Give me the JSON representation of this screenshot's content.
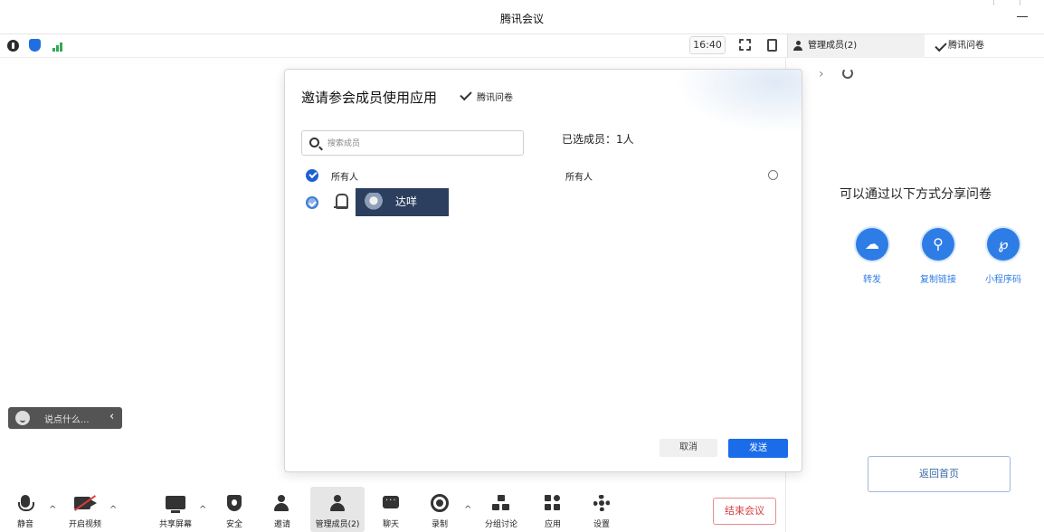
{
  "window": {
    "title": "腾讯会议"
  },
  "meetbar": {
    "time": "16:40",
    "members_tab": "管理成员(2)",
    "survey_tab": "腾讯问卷"
  },
  "dialog": {
    "title": "邀请参会成员使用应用",
    "app_name": "腾讯问卷",
    "search_placeholder": "搜索成员",
    "selected_label": "已选成员：1人",
    "all_label": "所有人",
    "member_name": "达咩",
    "selected_right": "所有人",
    "cancel_label": "取消",
    "send_label": "发送"
  },
  "right_panel": {
    "share_title": "可以通过以下方式分享问卷",
    "options": [
      {
        "label": "转发",
        "icon": "cloud-share-icon"
      },
      {
        "label": "复制链接",
        "icon": "link-icon"
      },
      {
        "label": "小程序码",
        "icon": "mini-program-icon"
      }
    ],
    "back_home": "返回首页"
  },
  "chat_input": {
    "placeholder": "说点什么..."
  },
  "toolbar": {
    "items": [
      {
        "label": "静音",
        "icon": "mic-icon"
      },
      {
        "label": "开启视频",
        "icon": "camera-off-icon"
      },
      {
        "label": "共享屏幕",
        "icon": "screen-share-icon"
      },
      {
        "label": "安全",
        "icon": "shield-icon"
      },
      {
        "label": "邀请",
        "icon": "invite-icon"
      },
      {
        "label": "管理成员(2)",
        "icon": "members-icon"
      },
      {
        "label": "聊天",
        "icon": "chat-icon"
      },
      {
        "label": "录制",
        "icon": "record-icon"
      },
      {
        "label": "分组讨论",
        "icon": "breakout-icon"
      },
      {
        "label": "应用",
        "icon": "apps-icon"
      },
      {
        "label": "设置",
        "icon": "gear-icon"
      }
    ],
    "end_meeting": "结束会议"
  },
  "colors": {
    "accent": "#1b6ce8",
    "end_meeting": "#d64040",
    "name_tag_bg": "#2c3f5e"
  }
}
